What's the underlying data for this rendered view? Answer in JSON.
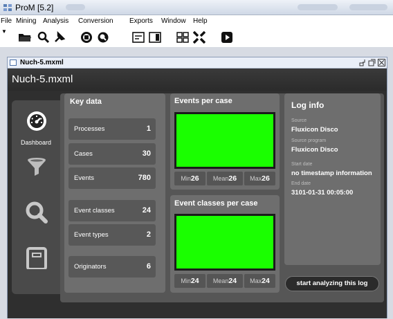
{
  "window": {
    "title": "ProM [5.2]",
    "icon": "prom-app-icon"
  },
  "menu": [
    "File",
    "Mining",
    "Analysis",
    "Conversion",
    "Exports",
    "Window",
    "Help"
  ],
  "toolbar": {
    "icons": [
      "open-folder-icon",
      "search-icon",
      "pin-tool-icon",
      "cycle-icon",
      "zoom-icon",
      "list-view-icon",
      "panel-view-icon",
      "grid-view-icon",
      "fullscreen-icon",
      "play-icon"
    ]
  },
  "frame": {
    "tab_title": "Nuch-5.mxml",
    "header_title": "Nuch-5.mxml"
  },
  "sidebar": {
    "items": [
      {
        "label": "Dashboard",
        "icon": "dashboard-gauge-icon",
        "selected": true
      },
      {
        "label": "",
        "icon": "filter-funnel-icon"
      },
      {
        "label": "",
        "icon": "inspect-magnifier-icon"
      },
      {
        "label": "",
        "icon": "document-icon"
      }
    ]
  },
  "key_data": {
    "title": "Key data",
    "rows": [
      {
        "label": "Processes",
        "value": "1"
      },
      {
        "label": "Cases",
        "value": "30"
      },
      {
        "label": "Events",
        "value": "780"
      },
      {
        "label": "Event classes",
        "value": "24"
      },
      {
        "label": "Event types",
        "value": "2"
      },
      {
        "label": "Originators",
        "value": "6"
      }
    ]
  },
  "events_per_case": {
    "title": "Events per case",
    "chart_color": "#1aff00",
    "min_label": "Min",
    "min": "26",
    "mean_label": "Mean",
    "mean": "26",
    "max_label": "Max",
    "max": "26"
  },
  "event_classes_per_case": {
    "title": "Event classes per case",
    "chart_color": "#1aff00",
    "min_label": "Min",
    "min": "24",
    "mean_label": "Mean",
    "mean": "24",
    "max_label": "Max",
    "max": "24"
  },
  "log_info": {
    "title": "Log info",
    "source_label": "Source",
    "source": "Fluxicon Disco",
    "program_label": "Source program",
    "program": "Fluxicon Disco",
    "start_label": "Start date",
    "start": "no timestamp information",
    "end_label": "End date",
    "end": "3101-01-31 00:05:00"
  },
  "start_button": "start analyzing this log"
}
